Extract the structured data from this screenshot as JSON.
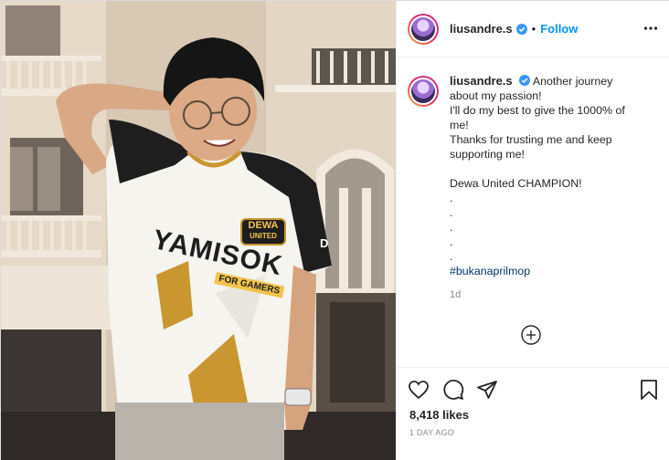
{
  "post": {
    "username": "liusandre.s",
    "separator": "•",
    "follow_label": "Follow",
    "icons": {
      "verified": "verified-badge-icon",
      "more": "more-options-icon",
      "like": "heart-icon",
      "comment": "comment-icon",
      "share": "paper-plane-icon",
      "save": "bookmark-icon",
      "load_more": "plus-circle-icon"
    },
    "caption": {
      "username": "liusandre.s",
      "lines": [
        "Another journey about my passion!",
        "I'll do my best to give the 1000% of me!",
        "Thanks for trusting me and keep supporting me!",
        "",
        "Dewa United CHAMPION!",
        ".",
        ".",
        ".",
        ".",
        "."
      ],
      "hashtag": "#bukanaprilmop",
      "relative_time": "1d"
    },
    "likes": "8,418 likes",
    "posted_ago": "1 DAY AGO",
    "photo": {
      "jersey_brand": "YAMISOK",
      "jersey_sub": "FOR GAMERS",
      "badge_top": "DEWA",
      "badge_bottom": "UNITED",
      "sleeve_mark": "D"
    },
    "colors": {
      "accent_blue": "#0095f6",
      "hashtag_blue": "#00376b",
      "muted_gray": "#8e8e8e",
      "jersey_gold": "#c9962f"
    }
  }
}
